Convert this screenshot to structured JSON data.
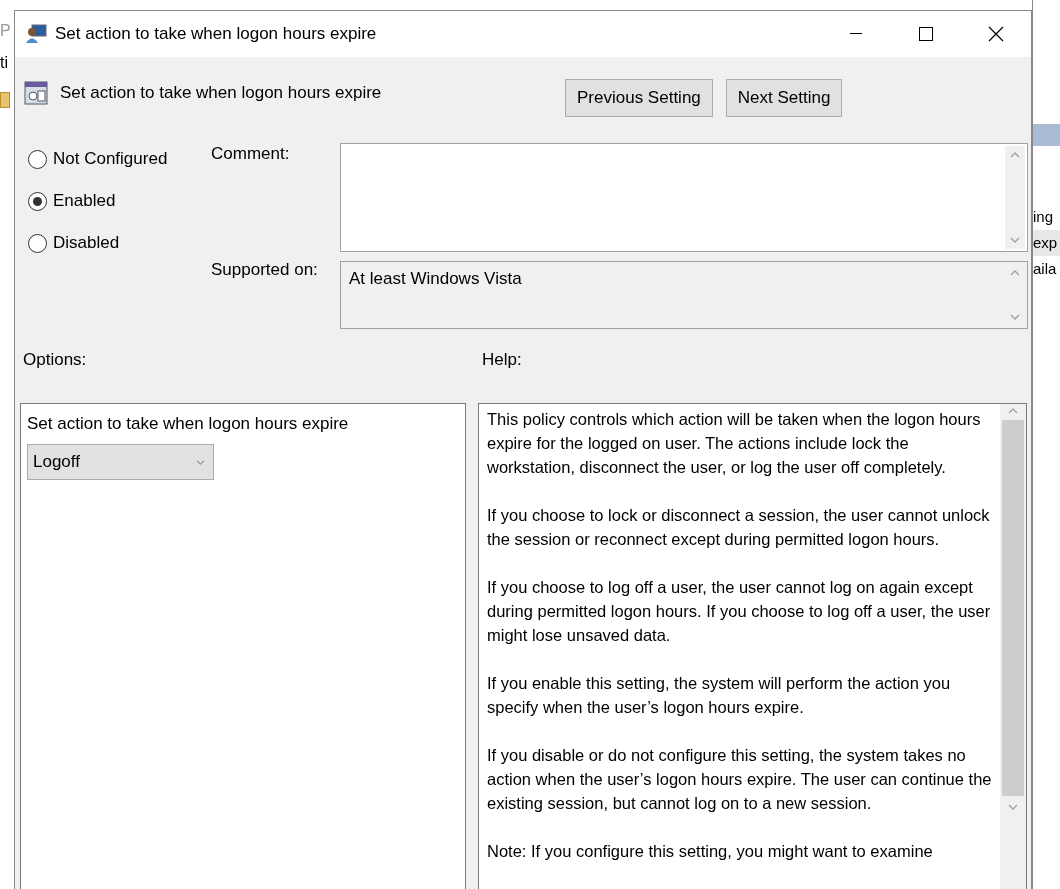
{
  "background_window": {
    "left_fragments": [
      "P",
      "ti"
    ],
    "right_fragments": [
      "ing",
      "exp",
      "aila"
    ]
  },
  "window": {
    "title": "Set action to take when logon hours expire"
  },
  "header": {
    "title": "Set action to take when logon hours expire",
    "buttons": [
      "Previous Setting",
      "Next Setting"
    ]
  },
  "state_options": [
    {
      "label": "Not Configured",
      "selected": false
    },
    {
      "label": "Enabled",
      "selected": true
    },
    {
      "label": "Disabled",
      "selected": false
    }
  ],
  "comment": {
    "label": "Comment:"
  },
  "supported_on": {
    "label": "Supported on:",
    "value": "At least Windows Vista"
  },
  "options": {
    "heading": "Options:",
    "label": "Set action to take when logon hours expire",
    "dropdown": {
      "value": "Logoff"
    }
  },
  "help": {
    "heading": "Help:",
    "paragraphs": [
      "This policy controls which action will be taken when the logon hours expire for the logged on user. The actions include lock the workstation, disconnect the user, or log the user off completely.",
      "If you choose to lock or disconnect a session, the user cannot unlock the session or reconnect except during permitted logon hours.",
      "If you choose to log off a user, the user cannot log on again except during permitted logon hours. If you choose to log off a user, the user might lose unsaved data.",
      "If you enable this setting, the system will perform the action you specify when the user’s logon hours expire.",
      "If you disable or do not configure this setting, the system takes no action when the user’s logon hours expire. The user can continue the existing session, but cannot log on to a new session.",
      "Note: If you configure this setting, you might want to examine"
    ]
  }
}
